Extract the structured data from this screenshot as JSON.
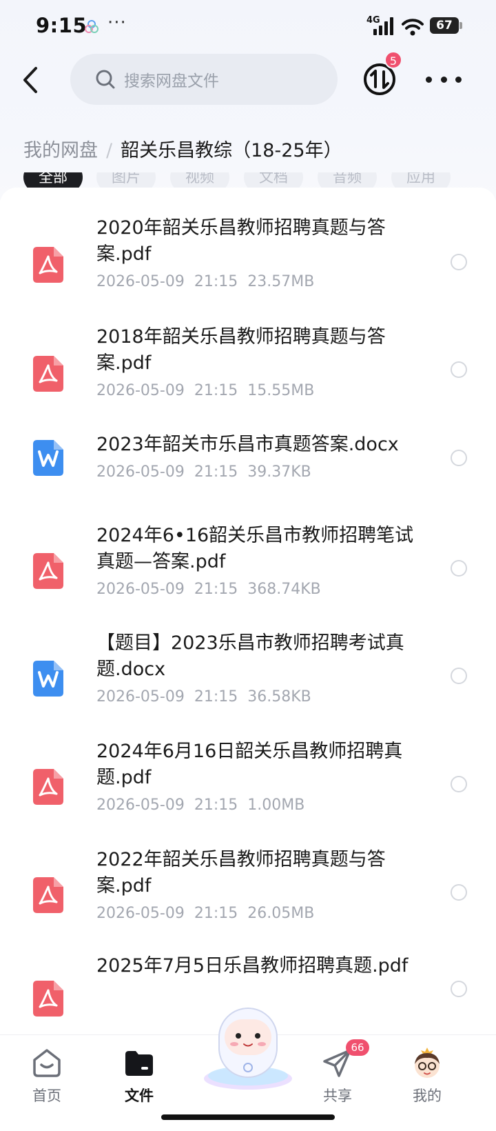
{
  "status_bar": {
    "time": "9:15",
    "more": "···",
    "network": "4G",
    "battery": "67",
    "icons": [
      "app-notification-icon",
      "signal-icon",
      "wifi-icon",
      "battery-icon"
    ]
  },
  "header": {
    "back_icon": "back-arrow-icon",
    "search_placeholder": "搜索网盘文件",
    "transfer_icon": "transfer-icon",
    "transfer_badge": "5",
    "more_icon": "more-icon"
  },
  "breadcrumb": {
    "root": "我的网盘",
    "separator": "/",
    "current": "韶关乐昌教综（18-25年）"
  },
  "filter_tabs": [
    {
      "label": "全部",
      "active": true
    },
    {
      "label": "图片",
      "active": false
    },
    {
      "label": "视频",
      "active": false
    },
    {
      "label": "文档",
      "active": false
    },
    {
      "label": "音频",
      "active": false
    },
    {
      "label": "应用",
      "active": false
    }
  ],
  "files": [
    {
      "name": "2020年韶关乐昌教师招聘真题与答案.pdf",
      "meta": "2026-05-09  21:15  23.57MB",
      "type": "pdf"
    },
    {
      "name": "2018年韶关乐昌教师招聘真题与答案.pdf",
      "meta": "2026-05-09  21:15  15.55MB",
      "type": "pdf"
    },
    {
      "name": "2023年韶关市乐昌市真题答案.docx",
      "meta": "2026-05-09  21:15  39.37KB",
      "type": "docx"
    },
    {
      "name": "2024年6•16韶关乐昌市教师招聘笔试真题—答案.pdf",
      "meta": "2026-05-09  21:15  368.74KB",
      "type": "pdf"
    },
    {
      "name": "【题目】2023乐昌市教师招聘考试真题.docx",
      "meta": "2026-05-09  21:15  36.58KB",
      "type": "docx"
    },
    {
      "name": "2024年6月16日韶关乐昌教师招聘真题.pdf",
      "meta": "2026-05-09  21:15  1.00MB",
      "type": "pdf"
    },
    {
      "name": "2022年韶关乐昌教师招聘真题与答案.pdf",
      "meta": "2026-05-09  21:15  26.05MB",
      "type": "pdf"
    },
    {
      "name": "2025年7月5日乐昌教师招聘真题.pdf",
      "meta": "",
      "type": "pdf"
    }
  ],
  "bottom_nav": [
    {
      "label": "首页",
      "icon": "home-icon",
      "active": false
    },
    {
      "label": "文件",
      "icon": "folder-icon",
      "active": true
    },
    {
      "label": "共享",
      "icon": "share-icon",
      "active": false,
      "badge": "66"
    },
    {
      "label": "我的",
      "icon": "profile-avatar-icon",
      "active": false
    }
  ],
  "colors": {
    "pdf": "#f0606a",
    "docx": "#3d8ef0",
    "badge": "#f0506e",
    "active_chip": "#1d1e22"
  }
}
